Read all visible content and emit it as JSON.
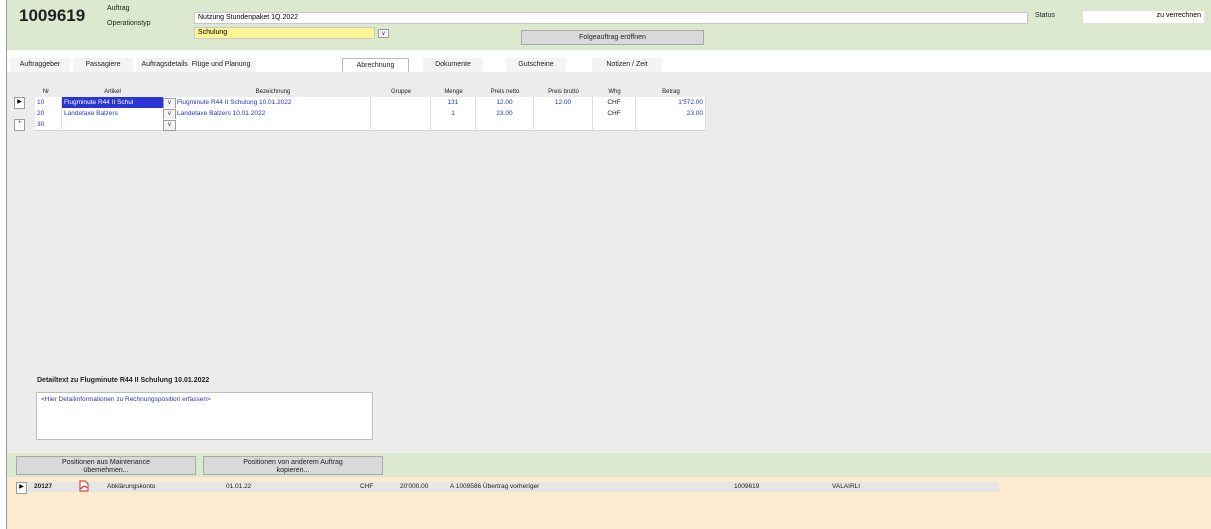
{
  "header": {
    "order_number": "1009619",
    "auftrag_label": "Auftrag",
    "auftrag_value": "Nutzung Stundenpaket 1Q.2022",
    "operationstyp_label": "Operationstyp",
    "operationstyp_value": "Schulung",
    "folgeauftrag_button": "Folgeauftrag eröffnen",
    "status_label": "Status",
    "status_value": "zu verrechnen"
  },
  "tabs": [
    {
      "label": "Auftraggeber",
      "active": false
    },
    {
      "label": "Passagiere",
      "active": false
    },
    {
      "label": "Auftragsdetails",
      "active": false
    },
    {
      "label": "Flüge und Planung",
      "active": false
    },
    {
      "label": "Abrechnung",
      "active": true
    },
    {
      "label": "Dokumente",
      "active": false
    },
    {
      "label": "Gutscheine",
      "active": false
    },
    {
      "label": "Notizen / Zeit",
      "active": false
    }
  ],
  "grid": {
    "columns": [
      "Nr",
      "Artikel",
      "Bezeichnung",
      "Gruppe",
      "Menge",
      "Preis netto",
      "Preis brutto",
      "Whg",
      "Betrag"
    ],
    "rows": [
      {
        "nr": "10",
        "artikel": "Flugminute R44 II Schul",
        "bezeichnung": "Flugminute R44 II Schulung 10.01.2022",
        "gruppe": "",
        "menge": "131",
        "preis_netto": "12.00",
        "preis_brutto": "12.00",
        "whg": "CHF",
        "betrag": "1'572.00"
      },
      {
        "nr": "20",
        "artikel": "Landetaxe Balzers",
        "bezeichnung": "Landetaxe Balzers 10.01.2022",
        "gruppe": "",
        "menge": "1",
        "preis_netto": "23.00",
        "preis_brutto": "",
        "whg": "CHF",
        "betrag": "23.00"
      },
      {
        "nr": "30",
        "artikel": "",
        "bezeichnung": "",
        "gruppe": "",
        "menge": "",
        "preis_netto": "",
        "preis_brutto": "",
        "whg": "",
        "betrag": ""
      }
    ]
  },
  "detail": {
    "title": "Detailtext zu Flugminute R44 II Schulung 10.01.2022",
    "placeholder": "<Hier Detailinformationen zu Rechnungsposition erfassen>"
  },
  "buttons": {
    "maintenance_line1": "Positionen aus Maintenance",
    "maintenance_line2": "übernehmen...",
    "copy_line1": "Positionen von anderem Auftrag",
    "copy_line2": "kopieren..."
  },
  "footer_row": {
    "id": "20127",
    "konto": "Abklärungskonto",
    "date": "01.01.22",
    "currency": "CHF",
    "amount": "20'000.00",
    "text": "A 1009586 Übertrag vorheriger",
    "order": "1009619",
    "user": "VALAIRLI"
  },
  "colors": {
    "header_bg": "#dce9cf",
    "footer_bg": "#fdebd0",
    "optype_bg": "#fbf596",
    "link_blue": "#2233cc"
  }
}
